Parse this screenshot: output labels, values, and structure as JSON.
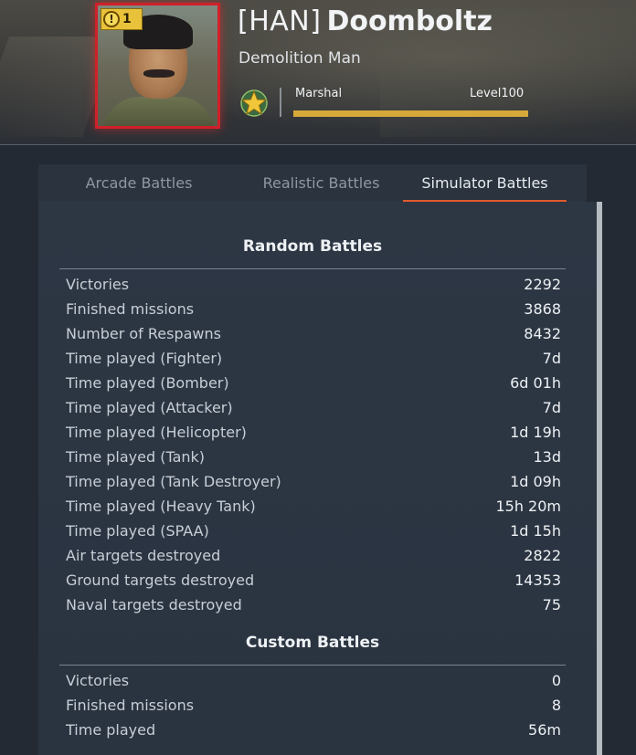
{
  "profile": {
    "clan_tag": "[HAN]",
    "nickname": "Doomboltz",
    "title": "Demolition Man",
    "rank_name": "Marshal",
    "level_label": "Level100",
    "level_progress": 1.0,
    "warning_count": "1",
    "warning_symbol": "!",
    "accent_color": "#d6a93a",
    "frame_color": "#d0202a",
    "star_icon": "rank-star-icon"
  },
  "tabs": [
    {
      "label": "Arcade Battles",
      "active": false
    },
    {
      "label": "Realistic Battles",
      "active": false
    },
    {
      "label": "Simulator Battles",
      "active": true
    }
  ],
  "random_battles": {
    "title": "Random Battles",
    "rows": [
      {
        "label": "Victories",
        "value": "2292"
      },
      {
        "label": "Finished missions",
        "value": "3868"
      },
      {
        "label": "Number of Respawns",
        "value": "8432"
      },
      {
        "label": "Time played (Fighter)",
        "value": "7d"
      },
      {
        "label": "Time played (Bomber)",
        "value": "6d 01h"
      },
      {
        "label": "Time played (Attacker)",
        "value": "7d"
      },
      {
        "label": "Time played (Helicopter)",
        "value": "1d 19h"
      },
      {
        "label": "Time played (Tank)",
        "value": "13d"
      },
      {
        "label": "Time played (Tank Destroyer)",
        "value": "1d 09h"
      },
      {
        "label": "Time played (Heavy Tank)",
        "value": "15h 20m"
      },
      {
        "label": "Time played (SPAA)",
        "value": "1d 15h"
      },
      {
        "label": "Air targets destroyed",
        "value": "2822"
      },
      {
        "label": "Ground targets destroyed",
        "value": "14353"
      },
      {
        "label": "Naval targets destroyed",
        "value": "75"
      }
    ]
  },
  "custom_battles": {
    "title": "Custom Battles",
    "rows": [
      {
        "label": "Victories",
        "value": "0"
      },
      {
        "label": "Finished missions",
        "value": "8"
      },
      {
        "label": "Time played",
        "value": "56m"
      }
    ]
  }
}
